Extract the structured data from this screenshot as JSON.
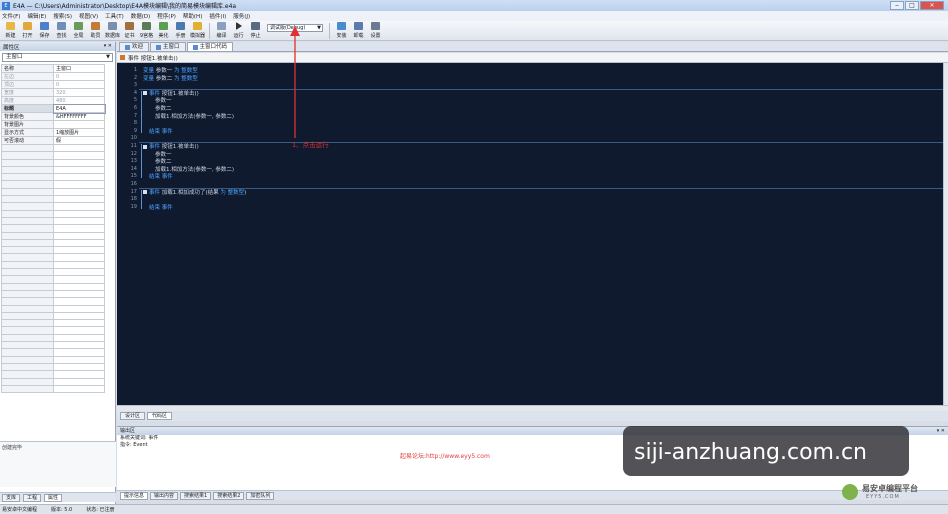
{
  "window": {
    "title": "E4A — C:\\Users\\Administrator\\Desktop\\E4A模块编辑\\我的简易模块编辑库.e4a",
    "icon_text": "E"
  },
  "menu": [
    "文件(F)",
    "编辑(E)",
    "搜索(S)",
    "视图(V)",
    "工具(T)",
    "数据(D)",
    "程序(P)",
    "帮助(H)",
    "插件(I)",
    "服务(J)"
  ],
  "toolbar": {
    "buttons": [
      {
        "label": "新建",
        "icon": "new-file-icon",
        "color": "#e6b84a"
      },
      {
        "label": "打开",
        "icon": "open-folder-icon",
        "color": "#e0a93e"
      },
      {
        "label": "保存",
        "icon": "save-icon",
        "color": "#4e7fc9"
      },
      {
        "label": "查找",
        "icon": "find-icon",
        "color": "#6f8fb8"
      },
      {
        "label": "全局",
        "icon": "global-icon",
        "color": "#6b9a5a"
      },
      {
        "label": "助员",
        "icon": "helper-icon",
        "color": "#c27c3a"
      },
      {
        "label": "数据库",
        "icon": "database-icon",
        "color": "#7a8fb0"
      },
      {
        "label": "证书",
        "icon": "certificate-icon",
        "color": "#a07040"
      },
      {
        "label": "9宫格",
        "icon": "grid-icon",
        "color": "#5a7a5a"
      },
      {
        "label": "美化",
        "icon": "beautify-icon",
        "color": "#5aa050"
      },
      {
        "label": "手册",
        "icon": "manual-icon",
        "color": "#4a7ab0"
      },
      {
        "label": "模拟器",
        "icon": "emulator-icon",
        "color": "#e0b030"
      }
    ],
    "run_buttons": [
      {
        "label": "编译",
        "icon": "compile-icon",
        "color": "#8aa0c0"
      },
      {
        "label": "运行",
        "icon": "run-icon",
        "color": "#333333"
      },
      {
        "label": "停止",
        "icon": "stop-icon",
        "color": "#5a6a80"
      }
    ],
    "build_mode": "调试版(Debug)",
    "extra_buttons": [
      {
        "label": "安装",
        "icon": "install-icon",
        "color": "#4a8ad0"
      },
      {
        "label": "卸载",
        "icon": "uninstall-icon",
        "color": "#5a7ab0"
      },
      {
        "label": "设置",
        "icon": "settings-icon",
        "color": "#6a7a90"
      }
    ]
  },
  "left_panel": {
    "title": "属性区",
    "object": "主窗口",
    "properties": [
      {
        "name": "名称",
        "value": "主窗口",
        "dim": false,
        "selected": false
      },
      {
        "name": "左边",
        "value": "0",
        "dim": true,
        "selected": false
      },
      {
        "name": "顶边",
        "value": "0",
        "dim": true,
        "selected": false
      },
      {
        "name": "宽度",
        "value": "320",
        "dim": true,
        "selected": false
      },
      {
        "name": "高度",
        "value": "480",
        "dim": true,
        "selected": false
      },
      {
        "name": "标题",
        "value": "E4A",
        "dim": false,
        "selected": true
      },
      {
        "name": "背景颜色",
        "value": "&HFFFFFFFF",
        "dim": false,
        "selected": false
      },
      {
        "name": "背景图片",
        "value": "",
        "dim": false,
        "selected": false
      },
      {
        "name": "显示方式",
        "value": "1缩放图片",
        "dim": false,
        "selected": false
      },
      {
        "name": "可否滚动",
        "value": "假",
        "dim": false,
        "selected": false
      }
    ],
    "empty_rows": 34,
    "description_label": "创建完毕",
    "tabs": [
      "支库",
      "工程",
      "属性"
    ]
  },
  "doc_tabs": [
    "欢迎",
    "主窗口",
    "主窗口代码"
  ],
  "editor": {
    "header": "事件 按钮1.被单击()",
    "lines": [
      {
        "n": "1",
        "text": [
          {
            "k": "变量 ",
            "kw": true
          },
          {
            "k": "参数一 ",
            "kw": false
          },
          {
            "k": "为 整数型",
            "kw": true
          }
        ],
        "indent": 0
      },
      {
        "n": "2",
        "text": [
          {
            "k": "变量 ",
            "kw": true
          },
          {
            "k": "参数二 ",
            "kw": false
          },
          {
            "k": "为 整数型",
            "kw": true
          }
        ],
        "indent": 0
      },
      {
        "n": "3",
        "text": [],
        "indent": 0
      },
      {
        "n": "4",
        "text": [
          {
            "k": "事件 ",
            "kw": true
          },
          {
            "k": "按钮1.被单击()",
            "kw": false
          }
        ],
        "indent": 0,
        "bullet": true
      },
      {
        "n": "5",
        "text": [
          {
            "k": "参数一",
            "kw": false
          }
        ],
        "indent": 2
      },
      {
        "n": "6",
        "text": [
          {
            "k": "参数二",
            "kw": false
          }
        ],
        "indent": 2
      },
      {
        "n": "7",
        "text": [
          {
            "k": "加载1.相加方法(参数一, 参数二)",
            "kw": false
          }
        ],
        "indent": 2
      },
      {
        "n": "8",
        "text": [],
        "indent": 0
      },
      {
        "n": "9",
        "text": [
          {
            "k": "结束 事件",
            "kw": true
          }
        ],
        "indent": 1
      },
      {
        "n": "10",
        "text": [],
        "indent": 0
      },
      {
        "n": "11",
        "text": [
          {
            "k": "事件 ",
            "kw": true
          },
          {
            "k": "按钮1.被单击()",
            "kw": false
          }
        ],
        "indent": 0,
        "bullet": true
      },
      {
        "n": "12",
        "text": [
          {
            "k": "参数一",
            "kw": false
          }
        ],
        "indent": 2
      },
      {
        "n": "13",
        "text": [
          {
            "k": "参数二",
            "kw": false
          }
        ],
        "indent": 2
      },
      {
        "n": "14",
        "text": [
          {
            "k": "加载1.相加方法(参数一, 参数二)",
            "kw": false
          }
        ],
        "indent": 2
      },
      {
        "n": "15",
        "text": [
          {
            "k": "结束 事件",
            "kw": true
          }
        ],
        "indent": 1
      },
      {
        "n": "16",
        "text": [],
        "indent": 0
      },
      {
        "n": "17",
        "text": [
          {
            "k": "事件 ",
            "kw": true
          },
          {
            "k": "加载1.相加成功了(结果 ",
            "kw": false
          },
          {
            "k": "为 整数型",
            "kw": true
          },
          {
            "k": ")",
            "kw": false
          }
        ],
        "indent": 0,
        "bullet": true
      },
      {
        "n": "18",
        "text": [],
        "indent": 0
      },
      {
        "n": "19",
        "text": [
          {
            "k": "结束 事件",
            "kw": true
          }
        ],
        "indent": 1
      }
    ]
  },
  "annotation": "1、点击运行",
  "design_tabs": [
    "设计区",
    "代码区"
  ],
  "output": {
    "title": "输出区",
    "lines": [
      "系统关键词: 事件",
      "指令: Event"
    ],
    "forum_text": "起易论坛:http://www.eyy5.com"
  },
  "bottom_tabs": [
    "提示信息",
    "输出内容",
    "搜索结果1",
    "搜索结果2",
    "加密队列"
  ],
  "status": [
    "易安卓中文编程",
    "版本: 5.0",
    "状态: 已注册"
  ],
  "watermark": {
    "text": "siji-anzhuang.com.cn",
    "brand": "易安卓编程平台",
    "brand_sub": "EYY5.COM"
  }
}
